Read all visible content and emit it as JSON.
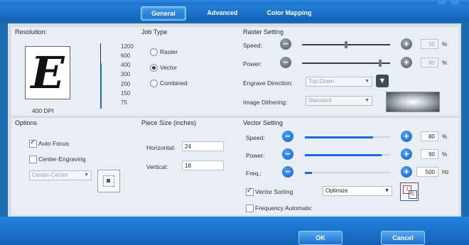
{
  "tabs": [
    {
      "label": "General"
    },
    {
      "label": "Advanced"
    },
    {
      "label": "Color Mapping"
    }
  ],
  "resolution": {
    "title": "Resolution:",
    "preview_letter": "E",
    "dpi_label": "400 DPI",
    "ticks": [
      "1200",
      "600",
      "400",
      "300",
      "200",
      "150",
      "75"
    ],
    "level_fraction": 0.7
  },
  "job_type": {
    "title": "Job Type",
    "options": [
      {
        "label": "Raster",
        "selected": false
      },
      {
        "label": "Vector",
        "selected": true
      },
      {
        "label": "Combined",
        "selected": false
      }
    ]
  },
  "raster": {
    "title": "Raster Setting",
    "speed_label": "Speed:",
    "power_label": "Power:",
    "speed_value": "50",
    "power_value": "90",
    "speed_level": 0.5,
    "power_level": 0.9,
    "percent_unit": "%",
    "engrave_label": "Engrave Direction:",
    "engrave_value": "Top-Down",
    "dither_label": "Image Dithering:",
    "dither_value": "Standard"
  },
  "options": {
    "title": "Options",
    "auto_focus_label": "Auto Focus",
    "auto_focus_checked": true,
    "center_engraving_label": "Center-Engraving",
    "center_engraving_checked": false,
    "center_select_value": "Center-Center"
  },
  "piece_size": {
    "title": "Piece Size (inches)",
    "horizontal_label": "Horizontal:",
    "horizontal_value": "24",
    "vertical_label": "Vertical:",
    "vertical_value": "18"
  },
  "vector": {
    "title": "Vector Setting",
    "speed_label": "Speed:",
    "power_label": "Power:",
    "freq_label": "Freq.:",
    "speed_value": "80",
    "power_value": "90",
    "freq_value": "500",
    "speed_level": 0.8,
    "power_level": 0.9,
    "freq_level": 0.08,
    "percent_unit": "%",
    "freq_unit": "Hz",
    "sorting_label": "Vector Sorting",
    "sorting_checked": true,
    "sorting_value": "Optimize",
    "freq_auto_label": "Frequency Automatic",
    "freq_auto_checked": false
  },
  "buttons": {
    "ok": "OK",
    "cancel": "Cancel"
  },
  "colors": {
    "accent": "#1b6ad8",
    "frame": "#1a6ab0"
  }
}
